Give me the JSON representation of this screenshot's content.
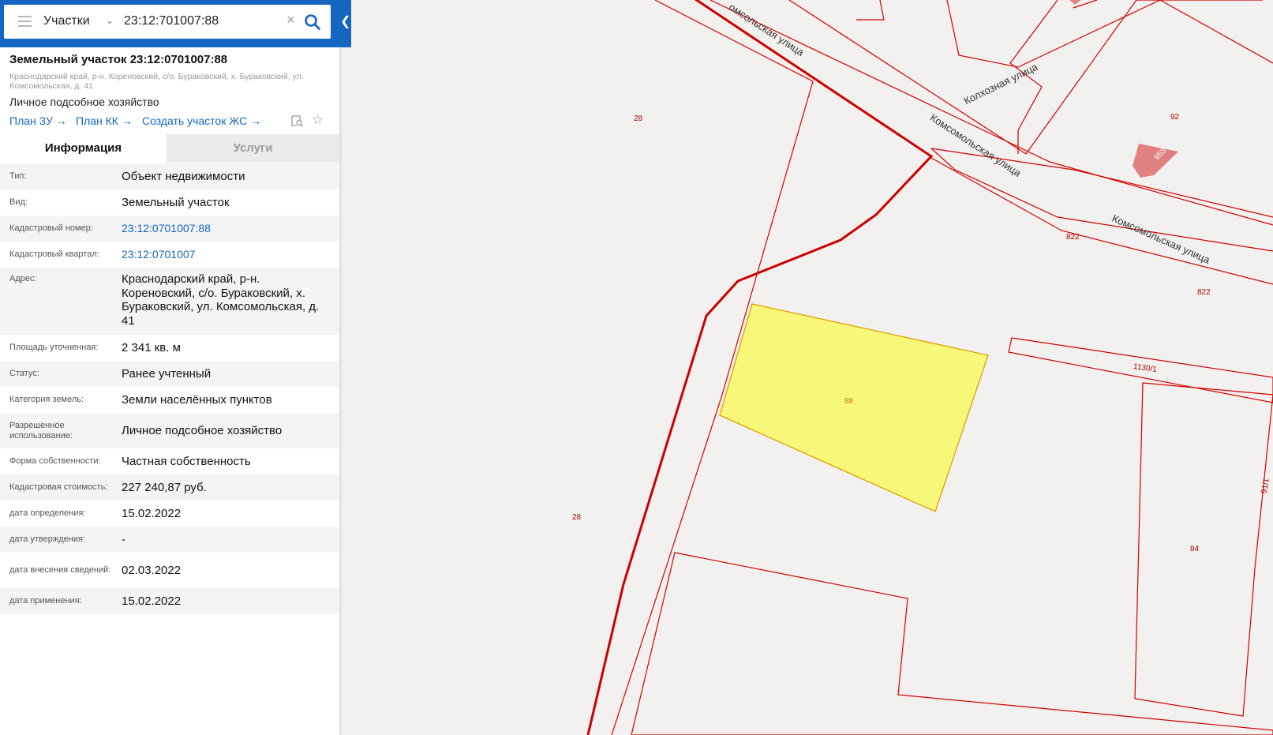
{
  "search": {
    "scope": "Участки",
    "query": "23:12:701007:88"
  },
  "object": {
    "title": "Земельный участок 23:12:0701007:88",
    "address_short": "Краснодарский край, р-н. Кореновский, с/о. Бураковский, х. Бураковский, ул. Комсомольская, д. 41",
    "use": "Личное подсобное хозяйство",
    "links": [
      "План ЗУ",
      "План КК",
      "Создать участок ЖС"
    ]
  },
  "tabs": [
    "Информация",
    "Услуги"
  ],
  "properties": [
    {
      "label": "Тип:",
      "value": "Объект недвижимости"
    },
    {
      "label": "Вид:",
      "value": "Земельный участок"
    },
    {
      "label": "Кадастровый номер:",
      "value": "23:12:0701007:88",
      "link": true
    },
    {
      "label": "Кадастровый квартал:",
      "value": "23:12:0701007",
      "link": true
    },
    {
      "label": "Адрес:",
      "value": "Краснодарский край, р-н. Кореновский, с/о. Бураковский, х. Бураковский, ул. Комсомольская, д. 41"
    },
    {
      "label": "Площадь уточненная:",
      "value": "2 341 кв. м"
    },
    {
      "label": "Статус:",
      "value": "Ранее учтенный"
    },
    {
      "label": "Категория земель:",
      "value": "Земли населённых пунктов"
    },
    {
      "label": "Разрешенное использование:",
      "value": "Личное подсобное хозяйство"
    },
    {
      "label": "Форма собственности:",
      "value": "Частная собственность"
    },
    {
      "label": "Кадастровая стоимость:",
      "value": "227 240,87 руб."
    },
    {
      "label": "дата определения:",
      "value": "15.02.2022"
    },
    {
      "label": "дата утверждения:",
      "value": "-"
    },
    {
      "label": "дата внесения сведений:",
      "value": "02.03.2022"
    },
    {
      "label": "дата применения:",
      "value": "15.02.2022"
    }
  ],
  "map": {
    "streets": [
      "Комсомольская улица",
      "Колхозная улица",
      "Комсомольская улица",
      "омсольская улица"
    ],
    "parcel_labels": [
      "28",
      "28",
      "92",
      "953",
      "822",
      "822",
      "88",
      "1130/1",
      "91/1",
      "84"
    ],
    "colors": {
      "boundary": "#d40000",
      "selected_fill": "#f7f77a",
      "selected_stroke": "#e0a000",
      "building": "#e08080"
    }
  }
}
